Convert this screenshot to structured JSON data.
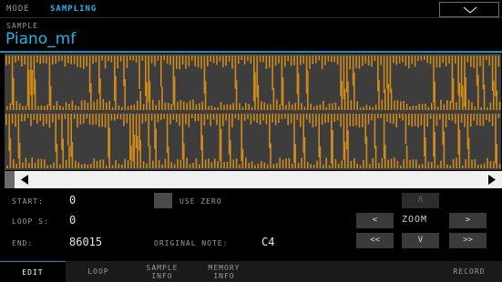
{
  "header": {
    "mode_label": "MODE",
    "mode_value": "SAMPLING",
    "dropdown_icon": "chevron-down-icon"
  },
  "sample": {
    "label": "SAMPLE",
    "name": "Piano_mf"
  },
  "colors": {
    "accent": "#1fb6e8",
    "waveform": "#d08a1a",
    "waveform_bg": "#3d3d3d"
  },
  "params": {
    "start_label": "START:",
    "start_value": "0",
    "loop_label": "LOOP S:",
    "loop_value": "0",
    "end_label": "END:",
    "end_value": "86015",
    "use_zero_label": "USE ZERO",
    "original_note_label": "ORIGINAL NOTE:",
    "original_note_value": "C4"
  },
  "zoom": {
    "label": "ZOOM",
    "up": "Λ",
    "left": "<",
    "right": ">",
    "fast_left": "<<",
    "down": "V",
    "fast_right": ">>"
  },
  "tabs": [
    {
      "line1": "EDIT",
      "line2": ""
    },
    {
      "line1": "LOOP",
      "line2": ""
    },
    {
      "line1": "SAMPLE",
      "line2": "INFO"
    },
    {
      "line1": "MEMORY",
      "line2": "INFO"
    },
    {
      "line1": "RECORD",
      "line2": ""
    }
  ]
}
